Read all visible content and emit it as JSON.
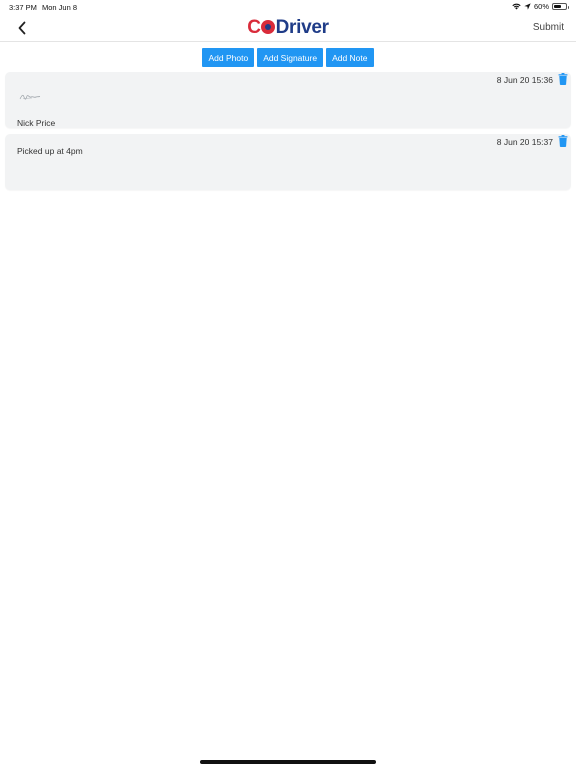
{
  "status": {
    "time": "3:37 PM",
    "date": "Mon Jun 8",
    "battery": "60%",
    "battery_level": 0.6
  },
  "header": {
    "logo_c": "C",
    "logo_driver": "Driver",
    "submit_label": "Submit"
  },
  "actions": {
    "add_photo": "Add Photo",
    "add_signature": "Add Signature",
    "add_note": "Add Note"
  },
  "entries": [
    {
      "timestamp": "8 Jun 20 15:36",
      "label": "Nick Price",
      "type": "signature"
    },
    {
      "timestamp": "8 Jun 20 15:37",
      "label": "Picked up at 4pm",
      "type": "note"
    }
  ],
  "colors": {
    "accent": "#2196f3",
    "brand_red": "#d92b3a",
    "brand_navy": "#1f3c88",
    "card_bg": "#f2f3f4"
  },
  "icons": [
    "back-chevron-icon",
    "wifi-icon",
    "location-arrow-icon",
    "battery-icon",
    "trash-icon",
    "signature-image"
  ]
}
